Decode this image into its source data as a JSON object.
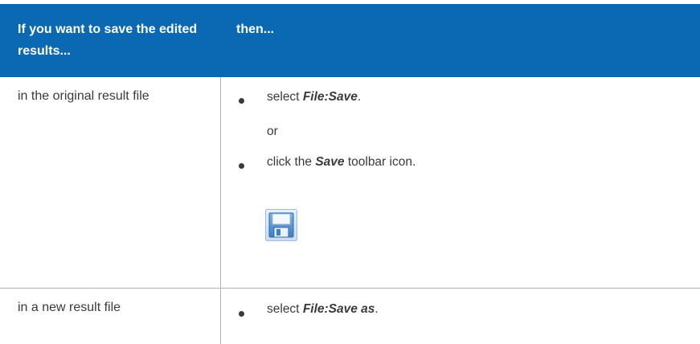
{
  "table": {
    "header": {
      "col1": "If you want to save the edited results...",
      "col2": "then..."
    },
    "rows": [
      {
        "condition": "in the original result file",
        "steps": [
          {
            "pre": "select ",
            "bold": "File:Save",
            "post": "."
          },
          {
            "or": "or"
          },
          {
            "pre": "click the ",
            "bold": "Save",
            "post": " toolbar icon."
          }
        ],
        "icon": "save-floppy-icon"
      },
      {
        "condition": "in a new result file",
        "steps": [
          {
            "pre": "select ",
            "bold": "File:Save as",
            "post": "."
          }
        ]
      }
    ]
  },
  "colors": {
    "header_bg": "#0b68b3",
    "header_text": "#ffffff",
    "body_text": "#3a3a3a",
    "grid": "#b3b3b3"
  }
}
